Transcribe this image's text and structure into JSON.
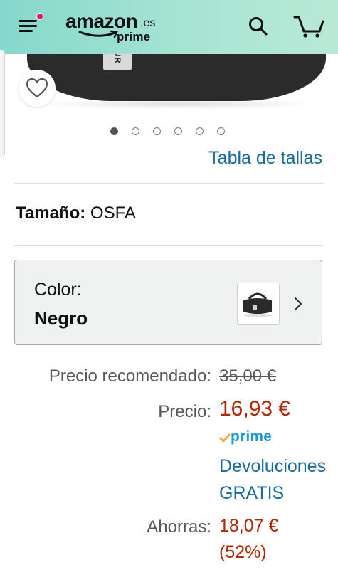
{
  "header": {
    "logo_text": "amazon",
    "logo_domain": ".es",
    "logo_sub": "prime",
    "icons": [
      "menu-icon",
      "search-icon",
      "cart-icon"
    ],
    "notification_color": "#e6175c"
  },
  "product": {
    "tag_text": "R OUR",
    "image_count": 6,
    "active_image": 1
  },
  "size_chart_link": "Tabla de tallas",
  "size": {
    "label": "Tamaño:",
    "value": "OSFA"
  },
  "color": {
    "label": "Color:",
    "value": "Negro"
  },
  "pricing": {
    "list_label": "Precio recomendado:",
    "list_price": "35,00 €",
    "price_label": "Precio:",
    "price": "16,93 €",
    "prime_label": "prime",
    "returns_line1": "Devoluciones",
    "returns_line2": "GRATIS",
    "savings_label": "Ahorras:",
    "savings_amount": "18,07 €",
    "savings_percent": "(52%)"
  },
  "colors": {
    "accent_link": "#1a6a9a",
    "price_red": "#b12704",
    "prime_blue": "#1a98d5"
  }
}
